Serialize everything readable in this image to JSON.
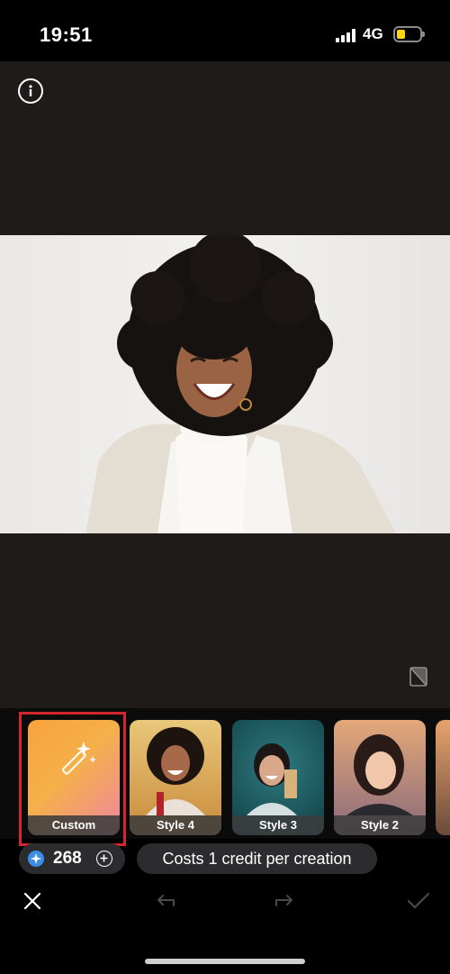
{
  "status_bar": {
    "time": "19:51",
    "network": "4G"
  },
  "styles": [
    {
      "label": "Custom",
      "selected": true
    },
    {
      "label": "Style 4"
    },
    {
      "label": "Style 3"
    },
    {
      "label": "Style 2"
    }
  ],
  "credits": {
    "count": "268"
  },
  "cost_note": "Costs 1 credit per creation",
  "colors": {
    "highlight": "#d3262e",
    "credit_blue": "#3a8ee6",
    "battery": "#ffd60a"
  },
  "icons": {
    "info": "info-icon",
    "compare": "compare-icon",
    "magic": "magic-wand-icon",
    "close": "close-icon",
    "undo": "undo-icon",
    "redo": "redo-icon",
    "confirm": "checkmark-icon"
  }
}
